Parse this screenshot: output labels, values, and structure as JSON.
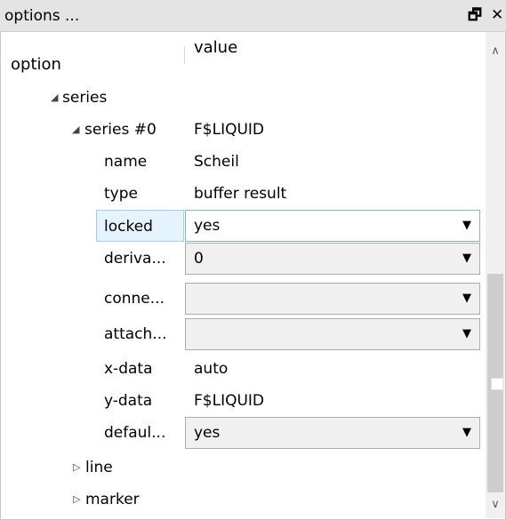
{
  "window": {
    "title": "options ...",
    "pin_icon": "restore-float-icon",
    "close_icon": "close-icon"
  },
  "columns": {
    "option": "option",
    "value": "value"
  },
  "tree": {
    "series": {
      "label": "series",
      "expanded": true
    },
    "series0": {
      "label": "series #0",
      "value": "F$LIQUID",
      "expanded": true
    },
    "props": {
      "name": {
        "label": "name",
        "value": "Scheil"
      },
      "type": {
        "label": "type",
        "value": "buffer result"
      },
      "locked": {
        "label": "locked",
        "value": "yes",
        "selected": true
      },
      "derivative": {
        "label": "deriva...",
        "value": "0"
      },
      "connect": {
        "label": "conne...",
        "value": ""
      },
      "attach": {
        "label": "attach...",
        "value": ""
      },
      "xdata": {
        "label": "x-data",
        "value": "auto"
      },
      "ydata": {
        "label": "y-data",
        "value": "F$LIQUID"
      },
      "default": {
        "label": "defaul...",
        "value": "yes"
      }
    },
    "line": {
      "label": "line",
      "expanded": false
    },
    "marker": {
      "label": "marker",
      "expanded": false
    }
  },
  "colors": {
    "titlebar": "#e4e4e4",
    "selection": "#e5f3ff",
    "selection_border": "#99d1ff",
    "combo_focus_border": "#7eb4ea"
  }
}
